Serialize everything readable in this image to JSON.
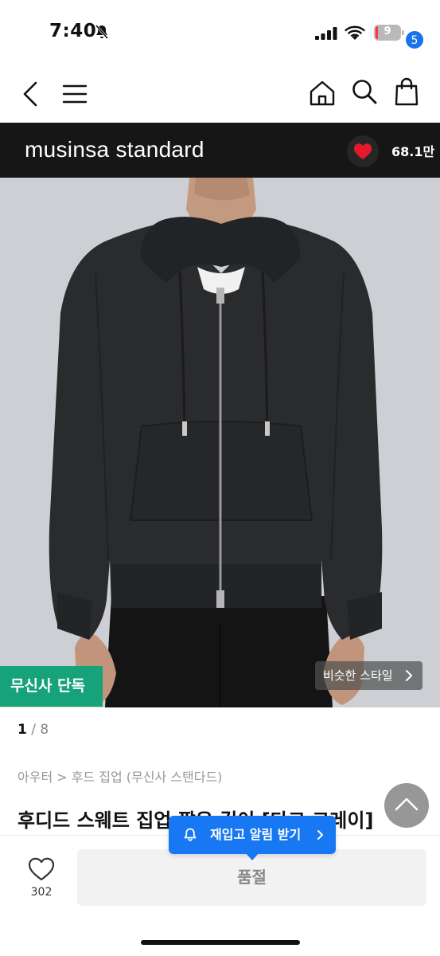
{
  "status_bar": {
    "time": "7:40",
    "battery_level": "9"
  },
  "nav": {
    "cart_count": "5"
  },
  "brand": {
    "name": "musinsa standard",
    "like_count": "68.1만"
  },
  "image": {
    "exclusive_badge": "무신사 단독",
    "similar_style_label": "비슷한 스타일",
    "current_index": "1",
    "separator": " / ",
    "total": "8"
  },
  "product": {
    "breadcrumb": "아우터 > 후드 집업 (무신사 스탠다드)",
    "title": "후디드 스웨트 집업 짧은 길이 [다크 그레이]"
  },
  "bottom": {
    "wish_count": "302",
    "soldout_label": "품절",
    "restock_label": "재입고 알림 받기"
  },
  "colors": {
    "brand_bar": "#161616",
    "exclusive_green": "#16a37a",
    "restock_blue": "#1877f2",
    "cart_badge_blue": "#1a73e8",
    "heart_red": "#e5192e"
  }
}
